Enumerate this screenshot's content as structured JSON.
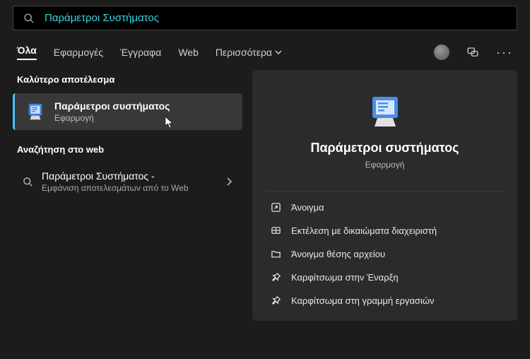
{
  "search": {
    "query": "Παράμετροι Συστήματος"
  },
  "tabs": {
    "all": "Όλα",
    "apps": "Εφαρμογές",
    "docs": "Έγγραφα",
    "web": "Web",
    "more": "Περισσότερα"
  },
  "left": {
    "best_heading": "Καλύτερο αποτέλεσμα",
    "best_title": "Παράμετροι συστήματος",
    "best_sub": "Εφαρμογή",
    "web_heading": "Αναζήτηση στο web",
    "web_item_title": "Παράμετροι Συστήματος -",
    "web_item_sub": "Εμφάνιση αποτελεσμάτων από το Web"
  },
  "detail": {
    "title": "Παράμετροι συστήματος",
    "sub": "Εφαρμογή",
    "actions": {
      "open": "Άνοιγμα",
      "admin": "Εκτέλεση με δικαιώματα διαχειριστή",
      "location": "Άνοιγμα θέσης αρχείου",
      "pin_start": "Καρφίτσωμα στην Έναρξη",
      "pin_taskbar": "Καρφίτσωμα στη γραμμή εργασιών"
    }
  }
}
